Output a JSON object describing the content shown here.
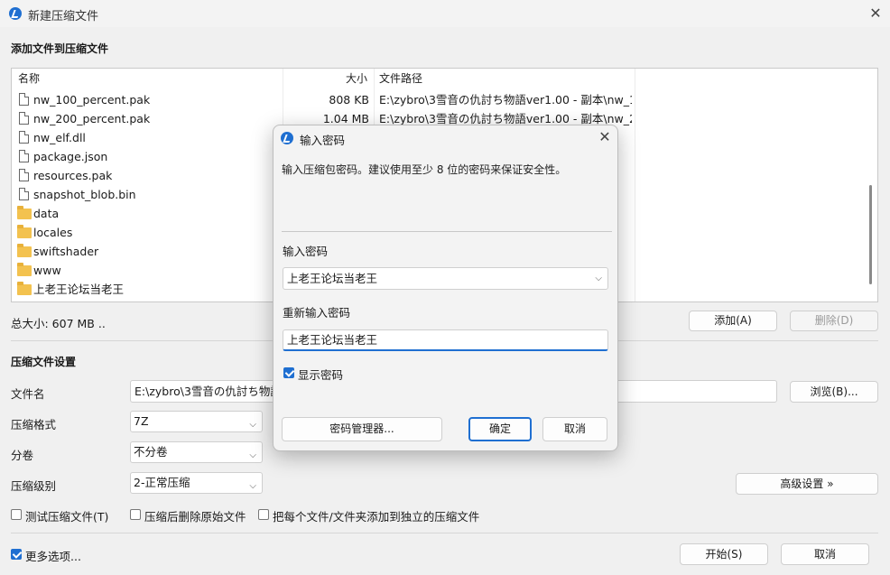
{
  "window": {
    "title": "新建压缩文件"
  },
  "add_section": {
    "title": "添加文件到压缩文件"
  },
  "file_list": {
    "columns": [
      "名称",
      "大小",
      "文件路径"
    ],
    "rows": [
      {
        "name": "nw_100_percent.pak",
        "size": "808 KB",
        "path": "E:\\zybro\\3雪音の仇討ち物語ver1.00 - 副本\\nw_1...",
        "kind": "file"
      },
      {
        "name": "nw_200_percent.pak",
        "size": "1.04 MB",
        "path": "E:\\zybro\\3雪音の仇討ち物語ver1.00 - 副本\\nw_2...",
        "kind": "file"
      },
      {
        "name": "nw_elf.dll",
        "size": "",
        "path": "",
        "kind": "file"
      },
      {
        "name": "package.json",
        "size": "",
        "path": "",
        "kind": "file"
      },
      {
        "name": "resources.pak",
        "size": "",
        "path": "",
        "kind": "file"
      },
      {
        "name": "snapshot_blob.bin",
        "size": "",
        "path": "",
        "kind": "file"
      },
      {
        "name": "data",
        "size": "",
        "path": "",
        "kind": "folder"
      },
      {
        "name": "locales",
        "size": "",
        "path": "",
        "kind": "folder"
      },
      {
        "name": "swiftshader",
        "size": "",
        "path": "",
        "kind": "folder"
      },
      {
        "name": "www",
        "size": "",
        "path": "",
        "kind": "folder"
      },
      {
        "name": "上老王论坛当老王",
        "size": "",
        "path": "",
        "kind": "folder"
      }
    ]
  },
  "total_size": "总大小: 607 MB ..",
  "buttons": {
    "add": "添加(A)",
    "delete": "删除(D)",
    "browse": "浏览(B)...",
    "advanced": "高级设置 »",
    "start": "开始(S)",
    "cancel": "取消"
  },
  "settings": {
    "title": "压缩文件设置",
    "filename_label": "文件名",
    "filename_value": "E:\\zybro\\3雪音の仇討ち物語",
    "format_label": "压缩格式",
    "format_value": "7Z",
    "volume_label": "分卷",
    "volume_value": "不分卷",
    "level_label": "压缩级别",
    "level_value": "2-正常压缩",
    "test_label": "测试压缩文件(T)",
    "delete_after_label": "压缩后删除原始文件",
    "separate_label": "把每个文件/文件夹添加到独立的压缩文件",
    "more_options_label": "更多选项..."
  },
  "password_dialog": {
    "title": "输入密码",
    "description": "输入压缩包密码。建议使用至少 8 位的密码来保证安全性。",
    "password_label": "输入密码",
    "password_value": "上老王论坛当老王",
    "confirm_label": "重新输入密码",
    "confirm_value": "上老王论坛当老王",
    "show_password_label": "显示密码",
    "manager_button": "密码管理器...",
    "ok_button": "确定",
    "cancel_button": "取消"
  },
  "colors": {
    "accent": "#1f6fd1",
    "folder": "#f3c24f"
  }
}
